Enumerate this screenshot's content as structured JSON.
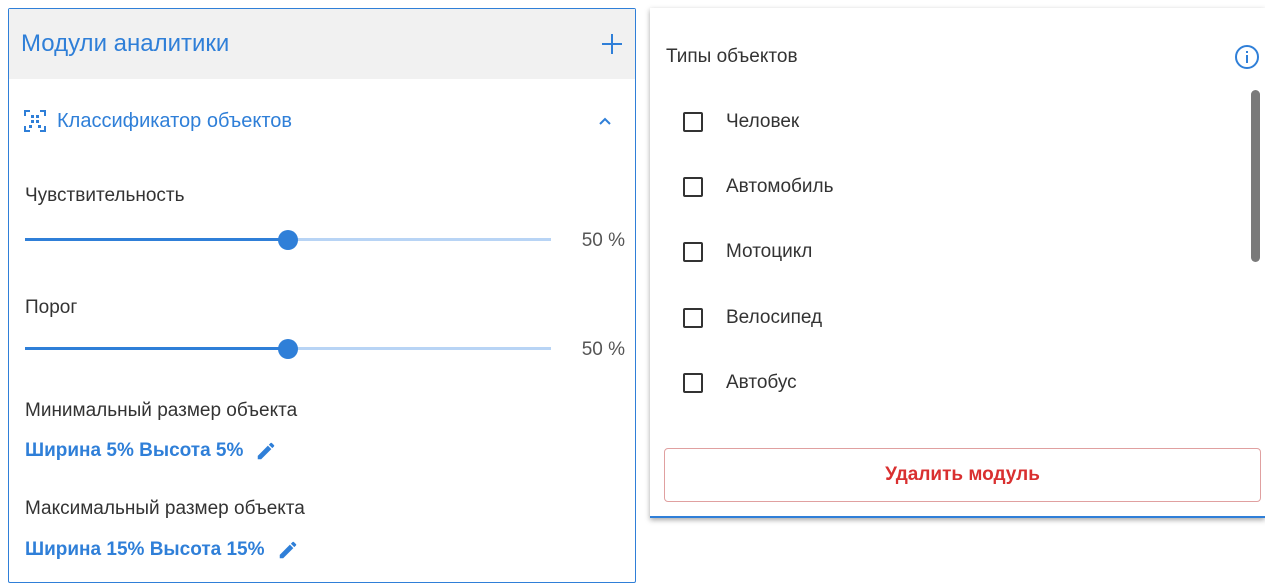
{
  "analytics_panel": {
    "title": "Модули аналитики",
    "add_icon": "plus-icon",
    "module": {
      "icon": "object-scan-icon",
      "name": "Классификатор объектов",
      "expand_icon": "chevron-up-icon"
    },
    "sensitivity": {
      "label": "Чувствительность",
      "value": 50,
      "value_text": "50 %"
    },
    "threshold": {
      "label": "Порог",
      "value": 50,
      "value_text": "50 %"
    },
    "min_size": {
      "label": "Минимальный размер объекта",
      "value_text": "Ширина 5% Высота 5%",
      "edit_icon": "pencil-icon"
    },
    "max_size": {
      "label": "Максимальный размер объекта",
      "value_text": "Ширина 15% Высота 15%",
      "edit_icon": "pencil-icon"
    },
    "accent_color": "#2f7fd8"
  },
  "types_panel": {
    "title": "Типы объектов",
    "info_icon": "info-icon",
    "items": [
      {
        "label": "Человек",
        "checked": false
      },
      {
        "label": "Автомобиль",
        "checked": false
      },
      {
        "label": "Мотоцикл",
        "checked": false
      },
      {
        "label": "Велосипед",
        "checked": false
      },
      {
        "label": "Автобус",
        "checked": false
      }
    ],
    "delete_label": "Удалить модуль",
    "delete_color": "#d93030"
  }
}
